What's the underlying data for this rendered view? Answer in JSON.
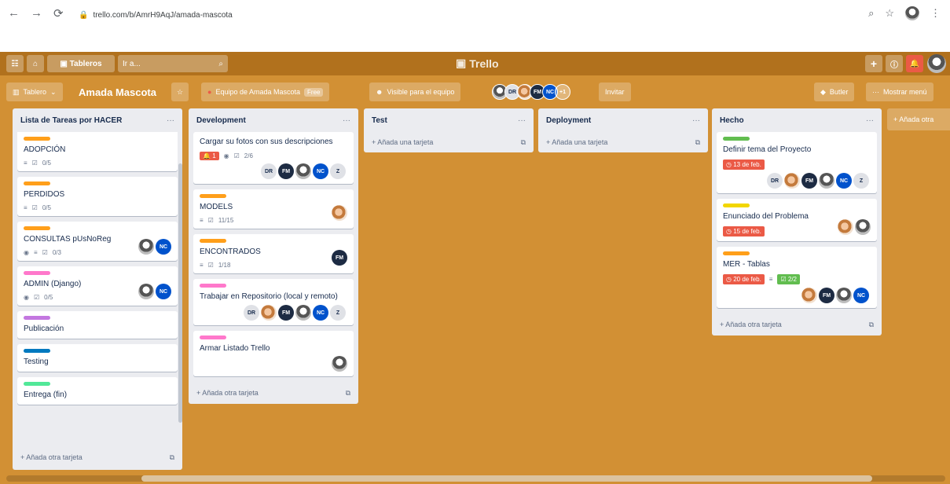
{
  "browser": {
    "url": "trello.com/b/AmrH9AqJ/amada-mascota"
  },
  "topbar": {
    "boards_label": "Tableros",
    "search_placeholder": "Ir a...",
    "logo": "Trello"
  },
  "board": {
    "tablero_btn": "Tablero",
    "title": "Amada Mascota",
    "team": "Equipo de Amada Mascota",
    "free": "Free",
    "visibility": "Visible para el equipo",
    "extra_members": "+1",
    "invite": "Invitar",
    "butler": "Butler",
    "show_menu": "Mostrar menú"
  },
  "lists": [
    {
      "name": "Lista de Tareas por HACER",
      "add": "Añada otra tarjeta",
      "cards": [
        {
          "title": "ADOPCIÓN",
          "checklist": "0/5"
        },
        {
          "title": "PERDIDOS",
          "checklist": "0/5"
        },
        {
          "title": "CONSULTAS pUsNoReg",
          "checklist": "0/3"
        },
        {
          "title": "ADMIN (Django)",
          "checklist": "0/5"
        },
        {
          "title": "Publicación"
        },
        {
          "title": "Testing"
        },
        {
          "title": "Entrega (fin)"
        }
      ]
    },
    {
      "name": "Development",
      "add": "Añada otra tarjeta",
      "cards": [
        {
          "title": "Cargar su fotos con sus descripciones",
          "count": "1",
          "checklist": "2/6"
        },
        {
          "title": "MODELS",
          "checklist": "11/15"
        },
        {
          "title": "ENCONTRADOS",
          "checklist": "1/18"
        },
        {
          "title": "Trabajar en Repositorio (local y remoto)"
        },
        {
          "title": "Armar Listado Trello"
        }
      ]
    },
    {
      "name": "Test",
      "add": "Añada una tarjeta"
    },
    {
      "name": "Deployment",
      "add": "Añada una tarjeta"
    },
    {
      "name": "Hecho",
      "add": "Añada otra tarjeta",
      "cards": [
        {
          "title": "Definir tema del Proyecto",
          "due": "13 de feb."
        },
        {
          "title": "Enunciado del Problema",
          "due": "15 de feb."
        },
        {
          "title": "MER - Tablas",
          "due": "20 de feb.",
          "checklist": "2/2"
        }
      ]
    }
  ],
  "add_list": "+ Añada otra",
  "members": {
    "dr": "DR",
    "fm": "FM",
    "nc": "NC",
    "z": "Z"
  },
  "colors": {
    "board_bg": "#d29034",
    "orange_label": "#ff9f1a",
    "pink_label": "#ff78cb",
    "purple_label": "#c377e0",
    "blue_label": "#0079bf",
    "green_label": "#51e898",
    "lime_label": "#61bd4f",
    "yellow_label": "#f2d600"
  }
}
